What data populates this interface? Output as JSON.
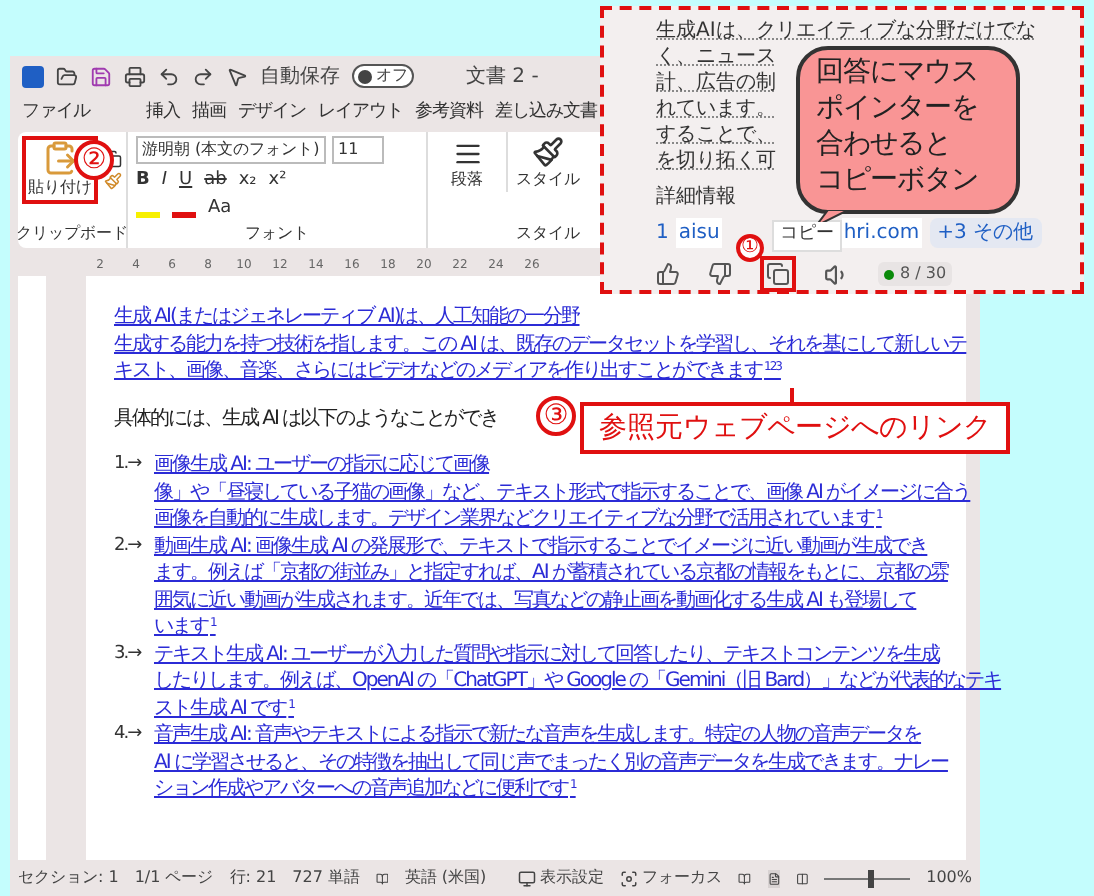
{
  "window": {
    "title": "文書 2 -"
  },
  "quick_access": {
    "autosave_label": "自動保存",
    "autosave": {
      "on": false,
      "label": "オフ"
    }
  },
  "ribbon_tabs": [
    {
      "label": "ファイル",
      "selected": false
    },
    {
      "label": "挿入",
      "selected": false
    },
    {
      "label": "描画",
      "selected": false
    },
    {
      "label": "デザイン",
      "selected": false
    },
    {
      "label": "レイアウト",
      "selected": false
    },
    {
      "label": "参考資料",
      "selected": false
    },
    {
      "label": "差し込み文書",
      "selected": false
    }
  ],
  "ribbon": {
    "clipboard": {
      "paste_label": "貼り付け",
      "group_label": "クリップボード"
    },
    "font": {
      "name": "游明朝 (本文のフォント)",
      "size": "11",
      "buttons": [
        "B",
        "I",
        "U",
        "ab",
        "x₂",
        "x²"
      ],
      "case_button": "Aa",
      "group_label": "フォント"
    },
    "paragraph": {
      "label": "段落"
    },
    "styles": {
      "label": "スタイル",
      "group_label": "スタイル"
    }
  },
  "ruler_marks": [
    "2",
    "4",
    "6",
    "8",
    "10",
    "12",
    "14",
    "16",
    "18",
    "20",
    "22",
    "24",
    "26"
  ],
  "document": {
    "paragraphs": [
      {
        "kind": "link",
        "lines": [
          "生成 AI(またはジェネレーティブ AI)は、人工知能の一分野",
          "生成する能力を持つ技術を指します。この AI は、既存のデータセットを学習し、それを基にして新しいテ",
          "キスト、画像、音楽、さらにはビデオなどのメディアを作り出すことができます"
        ],
        "ref": "123"
      },
      {
        "kind": "plain",
        "lines": [
          "具体的には、生成 AI は以下のようなことができ"
        ]
      },
      {
        "kind": "list_item",
        "number": "1.→",
        "lines": [
          "画像生成 AI: ユーザーの指示に応じて画像",
          "像」や「昼寝している子猫の画像」など、テキスト形式で指示することで、画像 AI がイメージに合う",
          "画像を自動的に生成します。デザイン業界などクリエイティブな分野で活用されています"
        ],
        "ref": "1"
      },
      {
        "kind": "list_item",
        "number": "2.→",
        "lines": [
          "動画生成 AI: 画像生成 AI の発展形で、テキストで指示することでイメージに近い動画が生成でき",
          "ます。例えば「京都の街並み」と指定すれば、AI が蓄積されている京都の情報をもとに、京都の雰",
          "囲気に近い動画が生成されます。近年では、写真などの静止画を動画化する生成 AI も登場して",
          "います"
        ],
        "ref": "1"
      },
      {
        "kind": "list_item",
        "number": "3.→",
        "lines": [
          "テキスト生成 AI: ユーザーが入力した質問や指示に対して回答したり、テキストコンテンツを生成",
          "したりします。例えば、OpenAI の「ChatGPT」や Google の「Gemini（旧 Bard）」などが代表的なテキ",
          "スト生成 AI です"
        ],
        "ref": "1"
      },
      {
        "kind": "list_item",
        "number": "4.→",
        "lines": [
          "音声生成 AI: 音声やテキストによる指示で新たな音声を生成します。特定の人物の音声データを",
          "AI に学習させると、その特徴を抽出して同じ声でまったく別の音声データを生成できます。ナレー",
          "ション作成やアバターへの音声追加などに便利です"
        ],
        "ref": "1"
      }
    ]
  },
  "status_bar": {
    "items": [
      "セクション: 1",
      "1/1 ページ",
      "行: 21",
      "727 単語"
    ],
    "language": "英語 (米国)",
    "display_settings": "表示設定",
    "focus": "フォーカス",
    "zoom": {
      "level": 0.5,
      "label": "100%"
    }
  },
  "assistant_panel": {
    "answer_lines": [
      "生成AIは、クリエイティブな分野だけでな",
      "く、ニュース",
      "計、広告の制",
      "れています。",
      "することで、",
      "を切り拓く可"
    ],
    "details_label": "詳細情報",
    "source": {
      "index": "1",
      "text_start": "aisu",
      "text_end": "hri.com"
    },
    "more_sources": "+3 その他",
    "tooltip": "コピー",
    "counter": "8 / 30"
  },
  "callouts": {
    "copy_number": "①",
    "paste_number": "②",
    "link_number": "③",
    "bubble_lines": [
      "回答にマウス",
      "ポインターを",
      "合わせると",
      "コピーボタン"
    ],
    "link_label": "参照元ウェブページへのリンク"
  }
}
